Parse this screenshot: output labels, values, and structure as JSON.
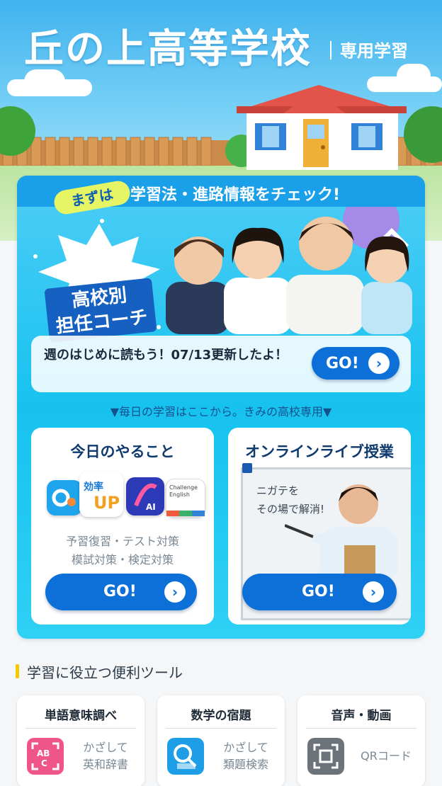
{
  "header": {
    "title": "丘の上高等学校",
    "subtitle": "専用学習"
  },
  "banner": {
    "pill": "まずは",
    "headline": "学習法・進路情報をチェック!",
    "coach_label": "高校別\n担任コーチ"
  },
  "notice": {
    "text": "週のはじめに読もう！07/13更新したよ！",
    "button_label": "GO!"
  },
  "daily": {
    "heading": "▼毎日の学習はここから。きみの高校専用▼",
    "today": {
      "title": "今日のやること",
      "desc_line1": "予習復習・テスト対策",
      "desc_line2": "模試対策・検定対策",
      "button_label": "GO!",
      "app_icons": [
        {
          "name": "quiz-app-icon",
          "label": "O"
        },
        {
          "name": "efficiency-up-app-icon",
          "label": "効率UP"
        },
        {
          "name": "ai-app-icon",
          "label": "AI"
        },
        {
          "name": "challenge-english-app-icon",
          "label": "Challenge English"
        }
      ]
    },
    "live": {
      "title": "オンラインライブ授業",
      "board_line1": "ニガテを",
      "board_line2": "その場で解消!",
      "button_label": "GO!"
    }
  },
  "tools": {
    "heading": "学習に役立つ便利ツール",
    "items": [
      {
        "title": "単語意味調べ",
        "line1": "かざして",
        "line2": "英和辞書",
        "icon": "abc-scan-icon",
        "color": "#f0558a"
      },
      {
        "title": "数学の宿題",
        "line1": "かざして",
        "line2": "類題検索",
        "icon": "search-scan-icon",
        "color": "#1f9ee8"
      },
      {
        "title": "音声・動画",
        "line1": "QRコード",
        "line2": "",
        "icon": "qr-scan-icon",
        "color": "#6d737a"
      }
    ]
  },
  "colors": {
    "accent": "#0d70d8",
    "panel": "#17c2ef",
    "sky": "#3fb3ee",
    "highlight": "#f5c800"
  }
}
